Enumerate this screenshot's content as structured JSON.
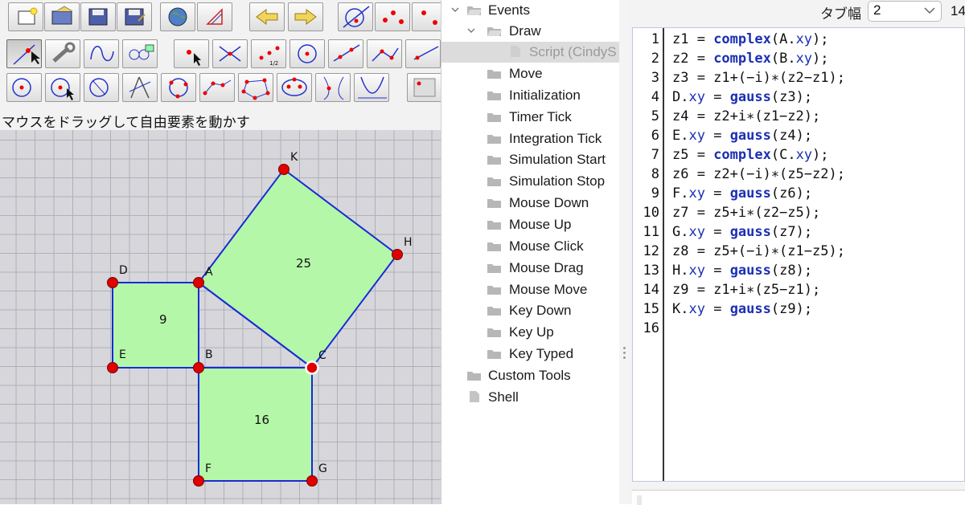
{
  "status_text": "マウスをドラッグして自由要素を動かす",
  "toolbar": {
    "row1": [
      "new-document",
      "open-file",
      "save-file",
      "save-as",
      "web-export",
      "geometry-inspector",
      "undo-arrow",
      "redo-arrow",
      "circle-line-tool",
      "points-tool"
    ],
    "row2": [
      "move-mode",
      "properties-wrench",
      "curve-mode",
      "delete-mode",
      "add-point",
      "add-segment",
      "add-midpoint",
      "add-circle",
      "add-line",
      "add-polyline",
      "add-ray"
    ],
    "row3": [
      "circle-by-center",
      "circle-by-radius",
      "compass-circle",
      "compass-tool",
      "circle-3-points",
      "polyline-points",
      "polygon-tool",
      "ellipse-tool",
      "conic-tool",
      "parabola-tool",
      "text-tool"
    ]
  },
  "geometry": {
    "points": [
      "K",
      "H",
      "D",
      "A",
      "E",
      "B",
      "C",
      "F",
      "G"
    ],
    "squares": [
      {
        "name": "square-AD",
        "label": "9",
        "color": "#b4f7a8"
      },
      {
        "name": "square-AC",
        "label": "25",
        "color": "#b4f7a8"
      },
      {
        "name": "square-BC",
        "label": "16",
        "color": "#b4f7a8"
      }
    ],
    "line_color": "#1a2bd6",
    "point_color": "#e00000"
  },
  "tree": {
    "events": "Events",
    "draw": "Draw",
    "script": "Script (CindyS",
    "items": [
      "Move",
      "Initialization",
      "Timer Tick",
      "Integration Tick",
      "Simulation Start",
      "Simulation Stop",
      "Mouse Down",
      "Mouse Up",
      "Mouse Click",
      "Mouse Drag",
      "Mouse Move",
      "Key Down",
      "Key Up",
      "Key Typed"
    ],
    "custom_tools": "Custom Tools",
    "shell": "Shell"
  },
  "editor": {
    "tab_width_label": "タブ幅",
    "tab_width_value": "2",
    "tab_width_extra": "14",
    "lines": [
      [
        [
          "z1 = ",
          ""
        ],
        [
          "complex",
          "kw"
        ],
        [
          "(A.",
          ""
        ],
        [
          "xy",
          "prop"
        ],
        [
          ");",
          ""
        ]
      ],
      [
        [
          "z2 = ",
          ""
        ],
        [
          "complex",
          "kw"
        ],
        [
          "(B.",
          ""
        ],
        [
          "xy",
          "prop"
        ],
        [
          ");",
          ""
        ]
      ],
      [
        [
          "z3 = z1+(−i)∗(z2−z1);",
          ""
        ]
      ],
      [
        [
          "D.",
          ""
        ],
        [
          "xy",
          "prop"
        ],
        [
          " = ",
          ""
        ],
        [
          "gauss",
          "kw"
        ],
        [
          "(z3);",
          ""
        ]
      ],
      [
        [
          "z4 = z2+i∗(z1−z2);",
          ""
        ]
      ],
      [
        [
          "E.",
          ""
        ],
        [
          "xy",
          "prop"
        ],
        [
          " = ",
          ""
        ],
        [
          "gauss",
          "kw"
        ],
        [
          "(z4);",
          ""
        ]
      ],
      [
        [
          "z5 = ",
          ""
        ],
        [
          "complex",
          "kw"
        ],
        [
          "(C.",
          ""
        ],
        [
          "xy",
          "prop"
        ],
        [
          ");",
          ""
        ]
      ],
      [
        [
          "z6 = z2+(−i)∗(z5−z2);",
          ""
        ]
      ],
      [
        [
          "F.",
          ""
        ],
        [
          "xy",
          "prop"
        ],
        [
          " = ",
          ""
        ],
        [
          "gauss",
          "kw"
        ],
        [
          "(z6);",
          ""
        ]
      ],
      [
        [
          "z7 = z5+i∗(z2−z5);",
          ""
        ]
      ],
      [
        [
          "G.",
          ""
        ],
        [
          "xy",
          "prop"
        ],
        [
          " = ",
          ""
        ],
        [
          "gauss",
          "kw"
        ],
        [
          "(z7);",
          ""
        ]
      ],
      [
        [
          "z8 = z5+(−i)∗(z1−z5);",
          ""
        ]
      ],
      [
        [
          "H.",
          ""
        ],
        [
          "xy",
          "prop"
        ],
        [
          " = ",
          ""
        ],
        [
          "gauss",
          "kw"
        ],
        [
          "(z8);",
          ""
        ]
      ],
      [
        [
          "z9 = z1+i∗(z5−z1);",
          ""
        ]
      ],
      [
        [
          "K.",
          ""
        ],
        [
          "xy",
          "prop"
        ],
        [
          " = ",
          ""
        ],
        [
          "gauss",
          "kw"
        ],
        [
          "(z9);",
          ""
        ]
      ],
      [
        [
          "",
          ""
        ]
      ]
    ]
  }
}
